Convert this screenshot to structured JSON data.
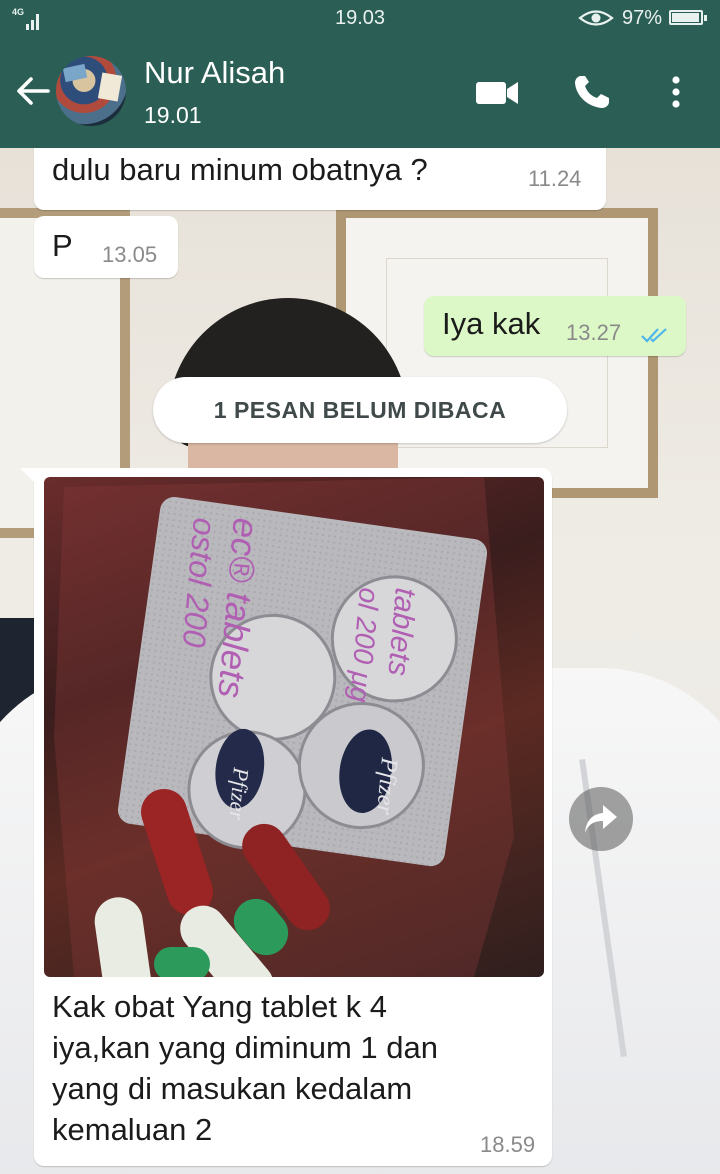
{
  "status_bar": {
    "network": "4G",
    "time": "19.03",
    "battery": "97%",
    "battery_level": 0.97
  },
  "header": {
    "contact_name": "Nur Alisah",
    "subtitle": "19.01",
    "icons": [
      "back-arrow-icon",
      "video-call-icon",
      "phone-call-icon",
      "more-options-icon"
    ]
  },
  "messages": [
    {
      "direction": "in",
      "text": "dulu baru minum obatnya ?",
      "time": "11.24"
    },
    {
      "direction": "in",
      "text": "P",
      "time": "13.05"
    },
    {
      "direction": "out",
      "text": "Iya kak",
      "time": "13.27",
      "status": "read"
    }
  ],
  "unread_banner": "1 PESAN BELUM DIBACA",
  "image_message": {
    "direction": "in",
    "caption_lines": [
      "Kak obat Yang tablet k 4",
      "iya,kan yang diminum 1 dan",
      "yang di masukan kedalam",
      "kemaluan 2"
    ],
    "time": "18.59",
    "photo_text": {
      "brand_a": "Pfizer",
      "brand_b": "Pfizer",
      "strip_a": "ec® tablets",
      "strip_b": "ostol 200",
      "strip_c": "tablets",
      "strip_d": "ol 200 μg"
    }
  },
  "colors": {
    "header": "#2b5f55",
    "incoming_bubble": "#ffffff",
    "outgoing_bubble": "#dcf8c6",
    "read_ticks": "#4fb6ec"
  }
}
